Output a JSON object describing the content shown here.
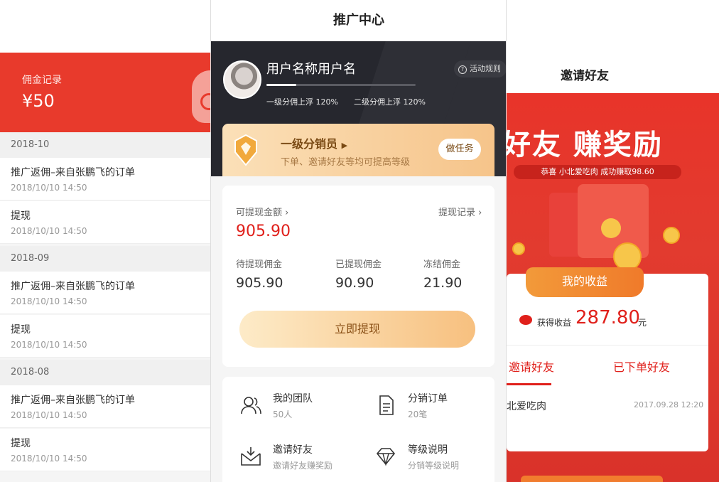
{
  "left": {
    "header": {
      "title": "佣金记录",
      "amount": "¥50"
    },
    "groups": [
      {
        "month": "2018-10",
        "items": [
          {
            "title": "推广返佣–来自张鹏飞的订单",
            "time": "2018/10/10 14:50"
          },
          {
            "title": "提现",
            "time": "2018/10/10 14:50"
          }
        ]
      },
      {
        "month": "2018-09",
        "items": [
          {
            "title": "推广返佣–来自张鹏飞的订单",
            "time": "2018/10/10 14:50"
          },
          {
            "title": "提现",
            "time": "2018/10/10 14:50"
          }
        ]
      },
      {
        "month": "2018-08",
        "items": [
          {
            "title": "推广返佣–来自张鹏飞的订单",
            "time": "2018/10/10 14:50"
          },
          {
            "title": "提现",
            "time": "2018/10/10 14:50"
          }
        ]
      }
    ]
  },
  "middle": {
    "title": "推广中心",
    "user": {
      "name": "用户名称用户名",
      "progress": 0.2,
      "level1": "一级分佣上浮 120%",
      "level2": "二级分佣上浮 120%"
    },
    "rules": "活动规则",
    "level": {
      "name": "一级分销员",
      "desc": "下单、邀请好友等均可提高等级",
      "task": "做任务"
    },
    "balance": {
      "withdrawable_label": "可提现金额",
      "withdrawable": "905.90",
      "records_link": "提现记录",
      "pending_label": "待提现佣金",
      "pending": "905.90",
      "withdrawn_label": "已提现佣金",
      "withdrawn": "90.90",
      "frozen_label": "冻结佣金",
      "frozen": "21.90",
      "button": "立即提现"
    },
    "features": [
      {
        "title": "我的团队",
        "sub": "50人",
        "icon": "team-icon"
      },
      {
        "title": "分销订单",
        "sub": "20笔",
        "icon": "order-icon"
      },
      {
        "title": "邀请好友",
        "sub": "邀请好友赚奖励",
        "icon": "invite-icon"
      },
      {
        "title": "等级说明",
        "sub": "分销等级说明",
        "icon": "diamond-icon"
      }
    ]
  },
  "right": {
    "title": "邀请好友",
    "slogan": "好友 赚奖励",
    "notice": "恭喜 小北爱吃肉 成功赚取98.60",
    "earnings_label": "我的收益",
    "earned_prefix": "获得收益",
    "earned_value": "287.80",
    "earned_unit": "元",
    "tabs": [
      "邀请好友",
      "已下单好友"
    ],
    "friend": {
      "name": "北爱吃肉",
      "time": "2017.09.28 12:20"
    }
  }
}
